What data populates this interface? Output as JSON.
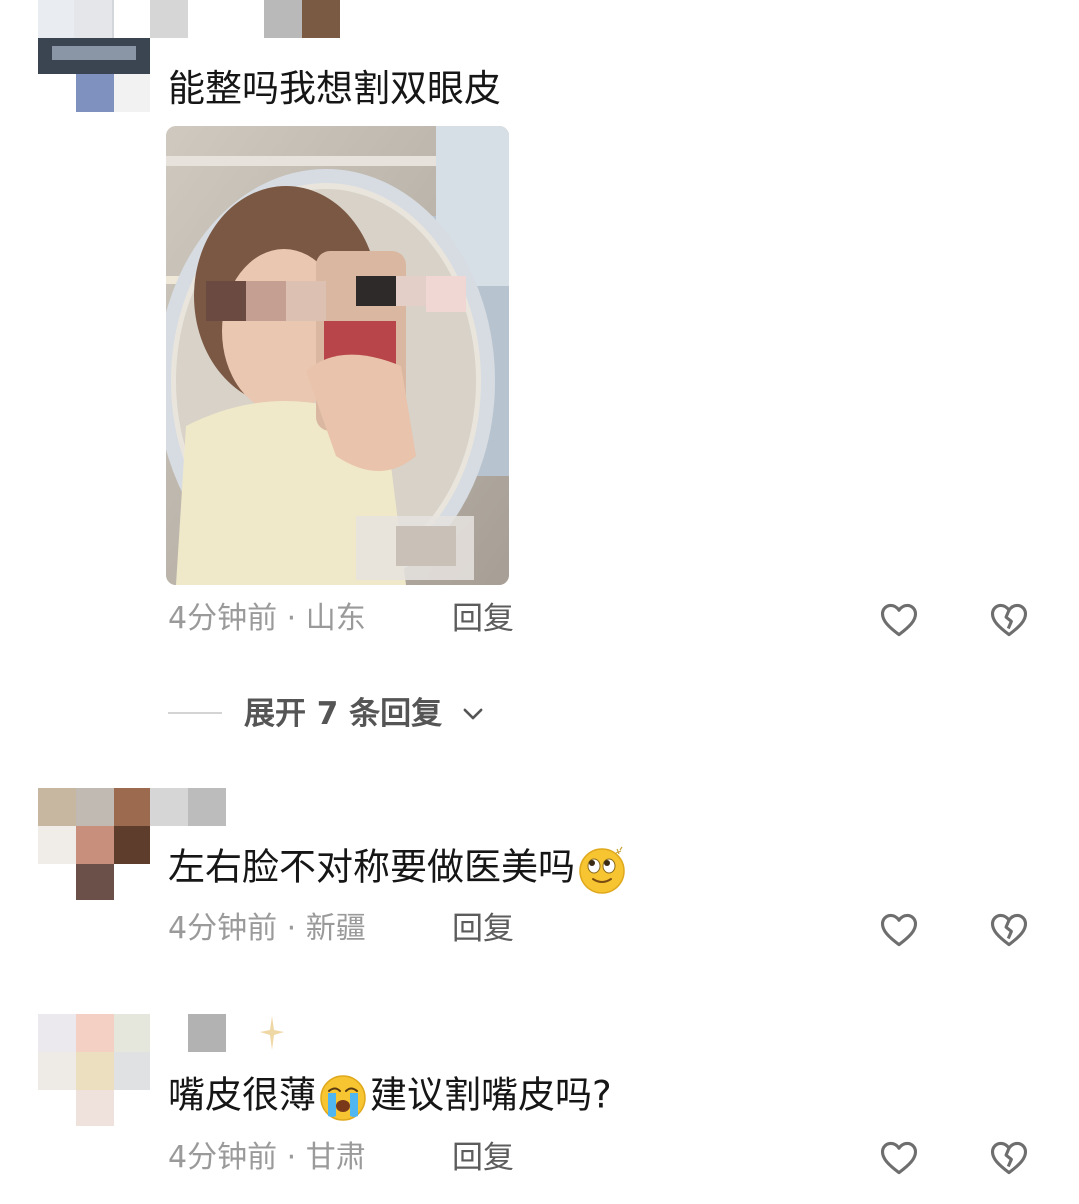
{
  "comments": [
    {
      "text": "能整吗我想割双眼皮",
      "time_location": "4分钟前 · 山东",
      "reply_label": "回复",
      "has_image": true
    },
    {
      "text_before_emoji": "左右脸不对称要做医美吗",
      "emoji": "rolling-eyes-emoji",
      "time_location": "4分钟前 · 新疆",
      "reply_label": "回复"
    },
    {
      "text_before_emoji": "嘴皮很薄",
      "emoji": "crying-emoji",
      "text_after_emoji": "建议割嘴皮吗?",
      "time_location": "4分钟前 · 甘肃",
      "reply_label": "回复"
    }
  ],
  "expand_replies": {
    "label": "展开 7 条回复"
  },
  "colors": {
    "text": "#161616",
    "meta": "#9a9a9a",
    "reply": "#5c5c5c",
    "icon": "#6e6e6e"
  }
}
